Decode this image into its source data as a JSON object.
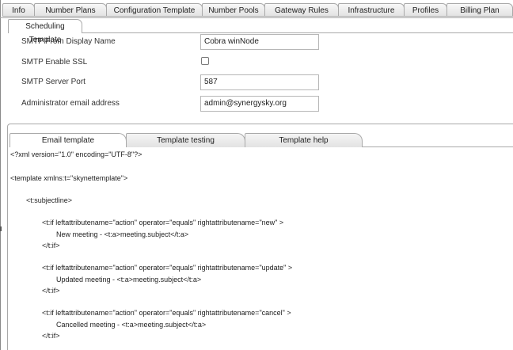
{
  "top_tabs": [
    {
      "label": "Info"
    },
    {
      "label": "Number Plans"
    },
    {
      "label": "Configuration Template"
    },
    {
      "label": "Number Pools"
    },
    {
      "label": "Gateway Rules"
    },
    {
      "label": "Infrastructure"
    },
    {
      "label": "Profiles"
    },
    {
      "label": "Billing Plan"
    }
  ],
  "active_tab": {
    "label": "Scheduling Template"
  },
  "form": {
    "smtp_from_display_name": {
      "label": "SMTP From Display Name",
      "value": "Cobra winNode"
    },
    "smtp_enable_ssl": {
      "label": "SMTP Enable SSL",
      "checked": false
    },
    "smtp_server_port": {
      "label": "SMTP Server Port",
      "value": "587"
    },
    "admin_email": {
      "label": "Administrator email address",
      "value": "admin@synergysky.org"
    }
  },
  "sub_tabs": [
    {
      "label": "Email template",
      "active": true
    },
    {
      "label": "Template testing",
      "active": false
    },
    {
      "label": "Template help",
      "active": false
    }
  ],
  "code_lines": [
    "<?xml version=\"1.0\" encoding=\"UTF-8\"?>",
    "<template xmlns:t=\"skynettemplate\">",
    "<t:subjectline>",
    "<t:if leftattributename=\"action\" operator=\"equals\" rightattributename=\"new\" >",
    "New meeting - <t:a>meeting.subject</t:a>",
    "</t:if>",
    "<t:if leftattributename=\"action\" operator=\"equals\" rightattributename=\"update\" >",
    "Updated meeting - <t:a>meeting.subject</t:a>",
    "</t:if>",
    "<t:if leftattributename=\"action\" operator=\"equals\" rightattributename=\"cancel\" >",
    "Cancelled meeting - <t:a>meeting.subject</t:a>",
    "</t:if>"
  ]
}
